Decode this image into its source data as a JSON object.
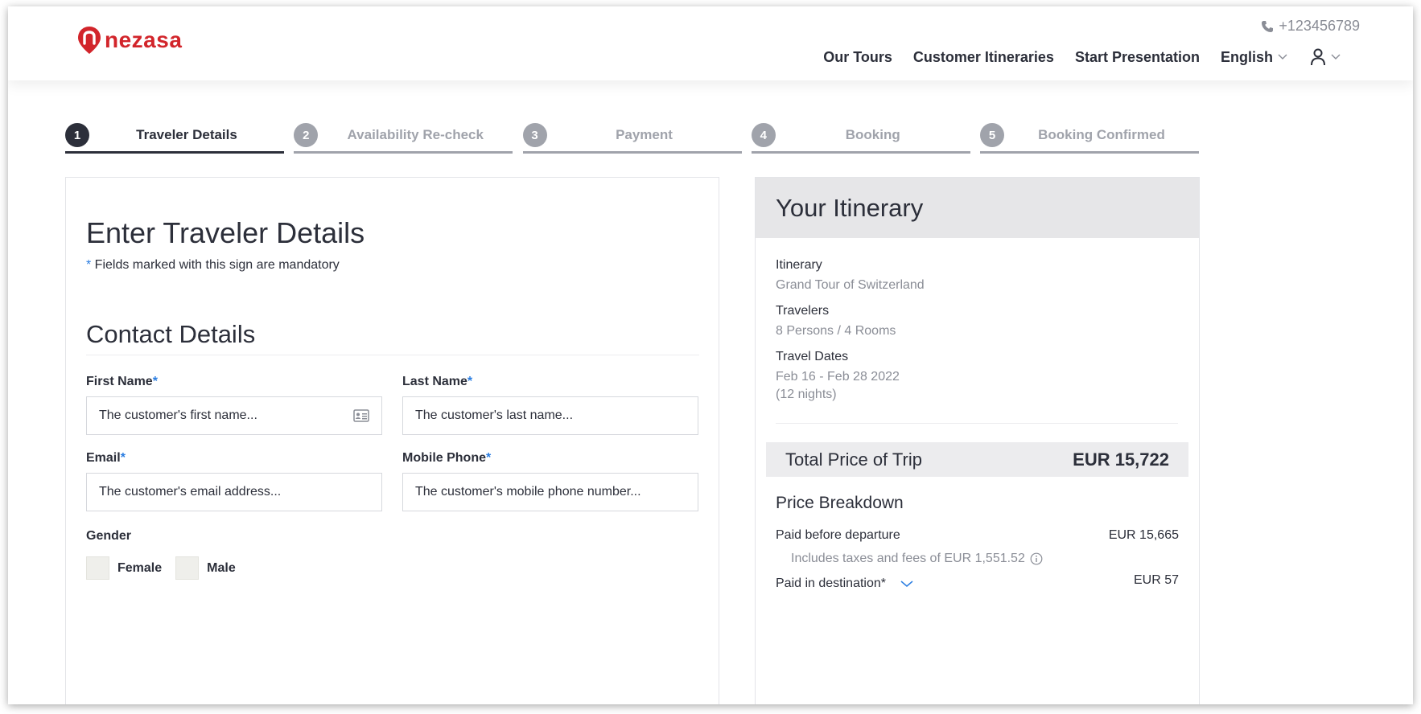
{
  "header": {
    "logo_text": "nezasa",
    "phone": "+123456789",
    "nav": [
      "Our Tours",
      "Customer Itineraries",
      "Start Presentation"
    ],
    "language": "English",
    "brand_color": "#d2252b"
  },
  "stepper": {
    "steps": [
      {
        "num": "1",
        "label": "Traveler Details",
        "active": true
      },
      {
        "num": "2",
        "label": "Availability Re-check",
        "active": false
      },
      {
        "num": "3",
        "label": "Payment",
        "active": false
      },
      {
        "num": "4",
        "label": "Booking",
        "active": false
      },
      {
        "num": "5",
        "label": "Booking Confirmed",
        "active": false
      }
    ]
  },
  "form": {
    "title": "Enter Traveler Details",
    "mandatory_star": "*",
    "mandatory_note": " Fields marked with this sign are mandatory",
    "section_title": "Contact Details",
    "first_name": {
      "label": "First Name",
      "placeholder": "The customer's first name..."
    },
    "last_name": {
      "label": "Last Name",
      "placeholder": "The customer's last name..."
    },
    "email": {
      "label": "Email",
      "placeholder": "The customer's email address..."
    },
    "mobile": {
      "label": "Mobile Phone",
      "placeholder": "The customer's mobile phone number..."
    },
    "gender": {
      "label": "Gender",
      "options": [
        "Female",
        "Male"
      ]
    },
    "required_mark": "*",
    "accent_color": "#2a7de1"
  },
  "itinerary": {
    "title": "Your Itinerary",
    "itinerary_label": "Itinerary",
    "itinerary_value": "Grand Tour of Switzerland",
    "travelers_label": "Travelers",
    "travelers_value": "8 Persons / 4 Rooms",
    "dates_label": "Travel Dates",
    "dates_value": "Feb 16 - Feb 28 2022",
    "nights": "(12 nights)",
    "total_label": "Total Price of Trip",
    "total_value": "EUR 15,722",
    "breakdown_title": "Price Breakdown",
    "before_departure_label": "Paid before departure",
    "before_departure_value": "EUR 15,665",
    "taxes_note": "Includes taxes and fees of EUR 1,551.52",
    "destination_label": "Paid in destination*",
    "destination_value": "EUR 57"
  }
}
